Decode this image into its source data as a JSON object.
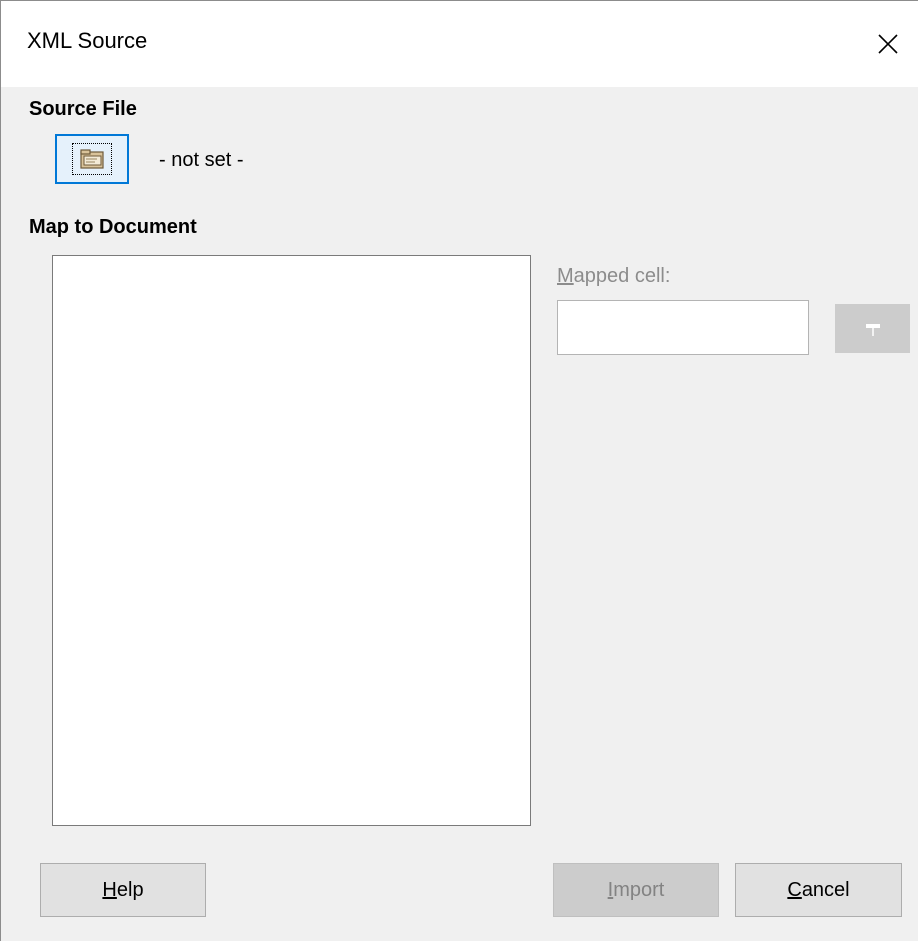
{
  "window": {
    "title": "XML Source",
    "close_icon": "close-icon"
  },
  "source_file": {
    "heading": "Source File",
    "browse_icon": "folder-icon",
    "status": "- not set -"
  },
  "map_to_document": {
    "heading": "Map to Document",
    "tree_items": []
  },
  "mapped_cell": {
    "label_mnemonic": "M",
    "label_rest": "apped cell:",
    "value": "",
    "ref_button_icon": "shrink-dialog-icon",
    "enabled": false
  },
  "buttons": {
    "help": {
      "mnemonic": "H",
      "rest": "elp"
    },
    "import": {
      "mnemonic": "I",
      "rest": "mport",
      "enabled": false
    },
    "cancel": {
      "mnemonic": "C",
      "rest": "ancel"
    }
  },
  "colors": {
    "focus_accent": "#0078d7",
    "dialog_bg": "#f0f0f0",
    "disabled_text": "#838383"
  }
}
